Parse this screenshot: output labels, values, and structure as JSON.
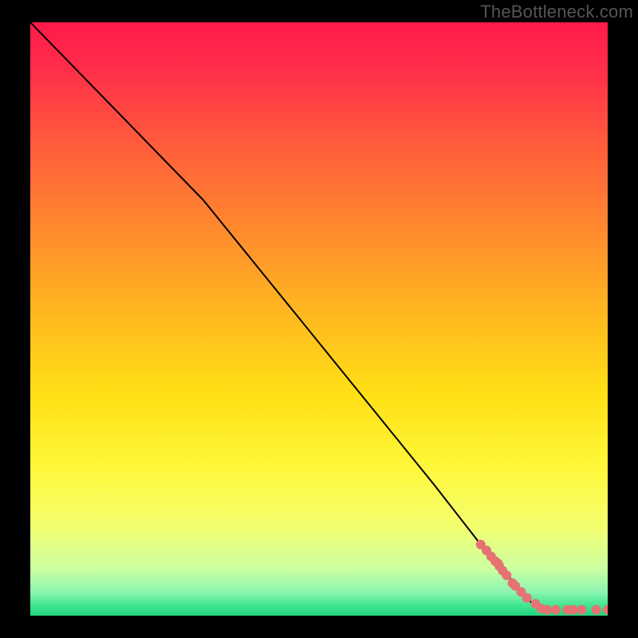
{
  "watermark": "TheBottleneck.com",
  "chart_data": {
    "type": "line",
    "title": "",
    "xlabel": "",
    "ylabel": "",
    "xlim": [
      0,
      100
    ],
    "ylim": [
      0,
      100
    ],
    "background_gradient": {
      "stops": [
        {
          "offset": 0.0,
          "color": "#ff1a4b"
        },
        {
          "offset": 0.08,
          "color": "#ff2e49"
        },
        {
          "offset": 0.2,
          "color": "#ff5a3c"
        },
        {
          "offset": 0.35,
          "color": "#ff8a2e"
        },
        {
          "offset": 0.5,
          "color": "#ffbb1f"
        },
        {
          "offset": 0.63,
          "color": "#ffe015"
        },
        {
          "offset": 0.75,
          "color": "#fff83a"
        },
        {
          "offset": 0.85,
          "color": "#f4ff70"
        },
        {
          "offset": 0.92,
          "color": "#ccffa0"
        },
        {
          "offset": 0.96,
          "color": "#8cf5b0"
        },
        {
          "offset": 0.985,
          "color": "#3be48e"
        },
        {
          "offset": 1.0,
          "color": "#25d27e"
        }
      ]
    },
    "series": [
      {
        "name": "curve",
        "type": "line",
        "color": "#000000",
        "x": [
          0,
          10,
          20,
          25,
          30,
          40,
          50,
          60,
          70,
          78,
          82,
          84,
          86,
          88
        ],
        "y": [
          100,
          90,
          80,
          75,
          70,
          58,
          46,
          34,
          22,
          12,
          8,
          5,
          3,
          1
        ]
      },
      {
        "name": "points",
        "type": "scatter",
        "color": "#e57373",
        "x": [
          78.0,
          79.0,
          79.8,
          80.5,
          81.0,
          81.2,
          81.8,
          82.5,
          83.5,
          84.0,
          85.0,
          86.0,
          87.5,
          88.5,
          89.5,
          91.0,
          93.0,
          94.0,
          95.5,
          98.0,
          100.0
        ],
        "y": [
          12.0,
          11.0,
          10.0,
          9.2,
          8.8,
          8.4,
          7.6,
          6.8,
          5.5,
          5.0,
          4.0,
          3.0,
          2.0,
          1.2,
          1.0,
          1.0,
          1.0,
          1.0,
          1.0,
          1.0,
          1.0
        ]
      }
    ]
  }
}
